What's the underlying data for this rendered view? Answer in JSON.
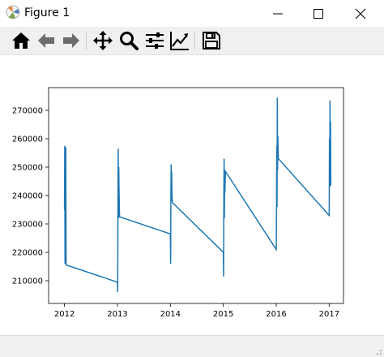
{
  "window": {
    "title": "Figure 1",
    "app_icon": "matplotlib-icon",
    "controls": [
      "minimize-icon",
      "maximize-icon",
      "close-icon"
    ]
  },
  "toolbar": {
    "tools": [
      {
        "name": "home-icon",
        "tooltip": "Reset original view"
      },
      {
        "name": "back-icon",
        "tooltip": "Back to previous view"
      },
      {
        "name": "forward-icon",
        "tooltip": "Forward to next view"
      },
      {
        "name": "pan-icon",
        "tooltip": "Pan axes"
      },
      {
        "name": "zoom-icon",
        "tooltip": "Zoom to rectangle"
      },
      {
        "name": "subplots-icon",
        "tooltip": "Configure subplots"
      },
      {
        "name": "edit-axes-icon",
        "tooltip": "Edit axis, curve and image parameters"
      },
      {
        "name": "save-icon",
        "tooltip": "Save the figure"
      }
    ]
  },
  "status": {
    "text": ""
  },
  "colors": {
    "line": "#1f77b4",
    "toolbar_bg": "#f0f0f0",
    "axes_edge": "#000000"
  },
  "chart_data": {
    "type": "line",
    "title": "",
    "xlabel": "",
    "ylabel": "",
    "xlim": [
      2011.7,
      2017.27
    ],
    "ylim": [
      202000,
      278000
    ],
    "xticks": [
      2012,
      2013,
      2014,
      2015,
      2016,
      2017
    ],
    "xtick_labels": [
      "2012",
      "2013",
      "2014",
      "2015",
      "2016",
      "2017"
    ],
    "yticks": [
      210000,
      220000,
      230000,
      240000,
      250000,
      260000,
      270000
    ],
    "ytick_labels": [
      "210000",
      "220000",
      "230000",
      "240000",
      "250000",
      "260000",
      "270000"
    ],
    "grid": false,
    "series": [
      {
        "name": "",
        "color": "#1f77b4",
        "x": [
          2012.0,
          2012.005,
          2012.01,
          2012.015,
          2012.02,
          2012.025,
          2012.03,
          2012.04,
          2013.0,
          2013.005,
          2013.01,
          2013.015,
          2013.02,
          2013.025,
          2013.03,
          2013.04,
          2014.0,
          2014.005,
          2014.01,
          2014.015,
          2014.02,
          2014.025,
          2014.03,
          2014.04,
          2015.0,
          2015.005,
          2015.01,
          2015.015,
          2015.02,
          2015.025,
          2015.03,
          2015.04,
          2016.0,
          2016.005,
          2016.01,
          2016.015,
          2016.02,
          2016.025,
          2016.03,
          2016.04,
          2017.0,
          2017.005,
          2017.01,
          2017.015,
          2017.02,
          2017.025,
          2017.03
        ],
        "y": [
          235000,
          257500,
          216000,
          246000,
          222000,
          257000,
          215500,
          215500,
          209500,
          206000,
          239000,
          256500,
          232000,
          250000,
          243000,
          232500,
          226500,
          216000,
          242000,
          251000,
          238000,
          248500,
          240000,
          237500,
          220000,
          211500,
          240000,
          253000,
          232000,
          246000,
          241000,
          248500,
          221000,
          234000,
          257500,
          236000,
          274500,
          249000,
          261000,
          253000,
          233000,
          260000,
          243000,
          273500,
          247000,
          266000,
          243500
        ]
      }
    ]
  }
}
